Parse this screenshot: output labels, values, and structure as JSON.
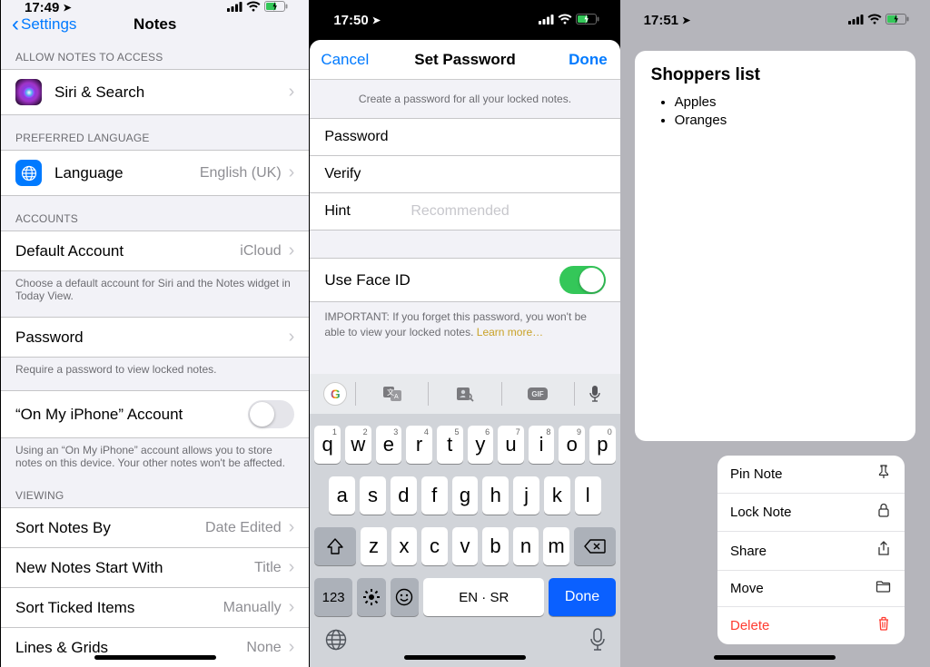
{
  "phone1": {
    "status": {
      "time": "17:49",
      "location_glyph": "➤"
    },
    "nav": {
      "back": "Settings",
      "title": "Notes"
    },
    "sections": {
      "allow_access": "ALLOW NOTES TO ACCESS",
      "siri": "Siri & Search",
      "preferred_lang": "PREFERRED LANGUAGE",
      "language": "Language",
      "language_value": "English (UK)",
      "accounts": "ACCOUNTS",
      "default_account": "Default Account",
      "default_account_value": "iCloud",
      "default_account_footer": "Choose a default account for Siri and the Notes widget in Today View.",
      "password": "Password",
      "password_footer": "Require a password to view locked notes.",
      "on_my_iphone": "“On My iPhone” Account",
      "on_my_iphone_footer": "Using an “On My iPhone” account allows you to store notes on this device. Your other notes won't be affected.",
      "viewing": "VIEWING",
      "sort_by": "Sort Notes By",
      "sort_by_value": "Date Edited",
      "new_notes": "New Notes Start With",
      "new_notes_value": "Title",
      "sort_ticked": "Sort Ticked Items",
      "sort_ticked_value": "Manually",
      "lines_grids": "Lines & Grids",
      "lines_grids_value": "None"
    }
  },
  "phone2": {
    "status": {
      "time": "17:50"
    },
    "nav": {
      "cancel": "Cancel",
      "title": "Set Password",
      "done": "Done"
    },
    "helper": "Create a password for all your locked notes.",
    "fields": {
      "password": "Password",
      "verify": "Verify",
      "hint": "Hint",
      "hint_placeholder": "Recommended"
    },
    "faceid": "Use Face ID",
    "warning": "IMPORTANT: If you forget this password, you won't be able to view your locked notes. ",
    "learn_more": "Learn more…",
    "keyboard": {
      "row1": [
        "q",
        "w",
        "e",
        "r",
        "t",
        "y",
        "u",
        "i",
        "o",
        "p"
      ],
      "row1_hints": [
        "1",
        "2",
        "3",
        "4",
        "5",
        "6",
        "7",
        "8",
        "9",
        "0"
      ],
      "row2": [
        "a",
        "s",
        "d",
        "f",
        "g",
        "h",
        "j",
        "k",
        "l"
      ],
      "row3": [
        "z",
        "x",
        "c",
        "v",
        "b",
        "n",
        "m"
      ],
      "numbers": "123",
      "space": "EN · SR",
      "done": "Done"
    }
  },
  "phone3": {
    "status": {
      "time": "17:51"
    },
    "note": {
      "title": "Shoppers list",
      "items": [
        "Apples",
        "Oranges"
      ]
    },
    "menu": {
      "pin": "Pin Note",
      "lock": "Lock Note",
      "share": "Share",
      "move": "Move",
      "delete": "Delete"
    }
  }
}
